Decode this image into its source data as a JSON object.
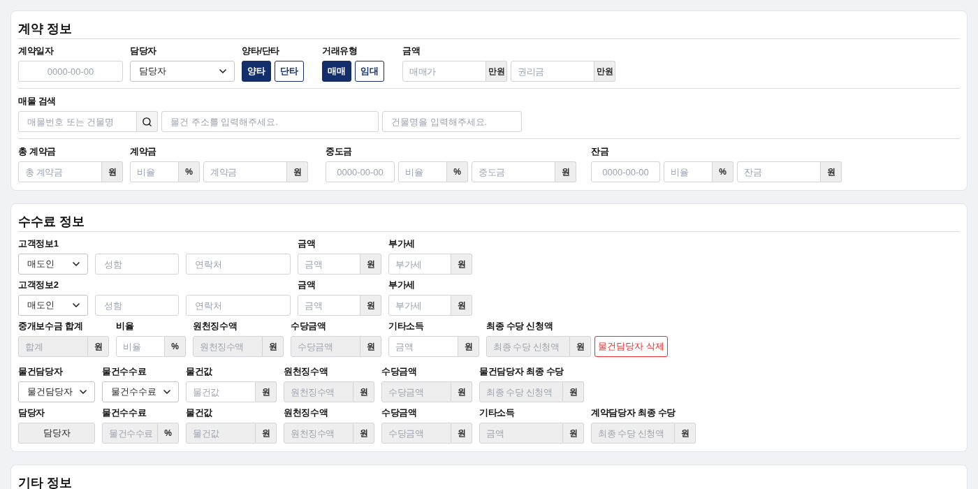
{
  "sections": [
    {
      "title": "계약 정보",
      "rows": [
        {
          "groups": [
            {
              "label": "계약일자",
              "controls": [
                {
                  "kind": "date",
                  "placeholder": "0000-00-00",
                  "disabled": false
                }
              ]
            },
            {
              "label": "담당자",
              "controls": [
                {
                  "kind": "select",
                  "value": "담당자"
                }
              ]
            },
            {
              "label": "양타/단타",
              "controls": [
                {
                  "kind": "toggle",
                  "label": "양타",
                  "selected": true
                },
                {
                  "kind": "toggle",
                  "label": "단타",
                  "selected": false
                }
              ]
            },
            {
              "label": "거래유형",
              "controls": [
                {
                  "kind": "toggle",
                  "label": "매매",
                  "selected": true
                },
                {
                  "kind": "toggle",
                  "label": "임대",
                  "selected": false
                }
              ]
            },
            {
              "label": "금액",
              "controls": [
                {
                  "kind": "unit",
                  "placeholder": "매매가",
                  "unit": "만원",
                  "disabled": false
                },
                {
                  "kind": "unit",
                  "placeholder": "권리금",
                  "unit": "만원",
                  "disabled": false
                }
              ]
            }
          ]
        },
        {
          "groups": [
            {
              "label": "매물 검색",
              "controls": [
                {
                  "kind": "search",
                  "placeholder": "매물번호 또는 건물명"
                },
                {
                  "kind": "input",
                  "placeholder": "물건 주소를 입력해주세요.",
                  "disabled": false
                },
                {
                  "kind": "input",
                  "placeholder": "건물명을 입력해주세요.",
                  "disabled": false
                }
              ]
            }
          ]
        },
        {
          "groups": [
            {
              "label": "총 계약금",
              "controls": [
                {
                  "kind": "unit",
                  "placeholder": "총 계약금",
                  "unit": "원",
                  "disabled": false
                }
              ]
            },
            {
              "label": "계약금",
              "controls": [
                {
                  "kind": "unit",
                  "placeholder": "비율",
                  "unit": "%",
                  "disabled": false
                },
                {
                  "kind": "unit",
                  "placeholder": "계약금",
                  "unit": "원",
                  "disabled": false
                }
              ]
            },
            {
              "label": "중도금",
              "controls": [
                {
                  "kind": "date",
                  "placeholder": "0000-00-00",
                  "disabled": false
                },
                {
                  "kind": "unit",
                  "placeholder": "비율",
                  "unit": "%",
                  "disabled": false
                },
                {
                  "kind": "unit",
                  "placeholder": "중도금",
                  "unit": "원",
                  "disabled": false
                }
              ]
            },
            {
              "label": "잔금",
              "controls": [
                {
                  "kind": "date",
                  "placeholder": "0000-00-00",
                  "disabled": false
                },
                {
                  "kind": "unit",
                  "placeholder": "비율",
                  "unit": "%",
                  "disabled": false
                },
                {
                  "kind": "unit",
                  "placeholder": "잔금",
                  "unit": "원",
                  "disabled": false
                }
              ]
            }
          ]
        }
      ]
    },
    {
      "title": "수수료 정보",
      "rows": [
        {
          "groups": [
            {
              "label": "고객정보1",
              "controls": [
                {
                  "kind": "select",
                  "value": "매도인"
                },
                {
                  "kind": "input",
                  "placeholder": "성함",
                  "disabled": false
                },
                {
                  "kind": "input",
                  "placeholder": "연락처",
                  "disabled": false
                }
              ]
            },
            {
              "label": "금액",
              "controls": [
                {
                  "kind": "unit",
                  "placeholder": "금액",
                  "unit": "원",
                  "disabled": false
                }
              ]
            },
            {
              "label": "부가세",
              "controls": [
                {
                  "kind": "unit",
                  "placeholder": "부가세",
                  "unit": "원",
                  "disabled": false
                }
              ]
            }
          ]
        },
        {
          "groups": [
            {
              "label": "고객정보2",
              "controls": [
                {
                  "kind": "select",
                  "value": "매도인"
                },
                {
                  "kind": "input",
                  "placeholder": "성함",
                  "disabled": false
                },
                {
                  "kind": "input",
                  "placeholder": "연락처",
                  "disabled": false
                }
              ]
            },
            {
              "label": "금액",
              "controls": [
                {
                  "kind": "unit",
                  "placeholder": "금액",
                  "unit": "원",
                  "disabled": false
                }
              ]
            },
            {
              "label": "부가세",
              "controls": [
                {
                  "kind": "unit",
                  "placeholder": "부가세",
                  "unit": "원",
                  "disabled": false
                }
              ]
            }
          ]
        },
        {
          "groups": [
            {
              "label": "중개보수금 합계",
              "controls": [
                {
                  "kind": "unit",
                  "placeholder": "합계",
                  "unit": "원",
                  "disabled": true
                }
              ]
            },
            {
              "label": "비율",
              "controls": [
                {
                  "kind": "unit",
                  "placeholder": "비율",
                  "unit": "%",
                  "disabled": false
                }
              ]
            },
            {
              "label": "원천징수액",
              "controls": [
                {
                  "kind": "unit",
                  "placeholder": "원천징수액",
                  "unit": "원",
                  "disabled": true
                }
              ]
            },
            {
              "label": "수당금액",
              "controls": [
                {
                  "kind": "unit",
                  "placeholder": "수당금액",
                  "unit": "원",
                  "disabled": true
                }
              ]
            },
            {
              "label": "기타소득",
              "controls": [
                {
                  "kind": "unit",
                  "placeholder": "금액",
                  "unit": "원",
                  "disabled": false
                }
              ]
            },
            {
              "label": "최종 수당 신청액",
              "controls": [
                {
                  "kind": "unit",
                  "placeholder": "최종 수당 신청액",
                  "unit": "원",
                  "disabled": true
                }
              ]
            },
            {
              "controls": [
                {
                  "kind": "danger",
                  "label": "물건담당자 삭제"
                }
              ]
            }
          ]
        },
        {
          "groups": [
            {
              "label": "물건담당자",
              "controls": [
                {
                  "kind": "select",
                  "value": "물건담당자"
                }
              ]
            },
            {
              "label": "물건수수료",
              "controls": [
                {
                  "kind": "select",
                  "value": "물건수수료"
                }
              ]
            },
            {
              "label": "물건값",
              "controls": [
                {
                  "kind": "unit",
                  "placeholder": "물건값",
                  "unit": "원",
                  "disabled": false
                }
              ]
            },
            {
              "label": "원천징수액",
              "controls": [
                {
                  "kind": "unit",
                  "placeholder": "원천징수액",
                  "unit": "원",
                  "disabled": true
                }
              ]
            },
            {
              "label": "수당금액",
              "controls": [
                {
                  "kind": "unit",
                  "placeholder": "수당금액",
                  "unit": "원",
                  "disabled": true
                }
              ]
            },
            {
              "label": "물건담당자 최종 수당",
              "controls": [
                {
                  "kind": "unit",
                  "placeholder": "최종 수당 신청액",
                  "unit": "원",
                  "disabled": true
                }
              ]
            }
          ]
        },
        {
          "groups": [
            {
              "label": "담당자",
              "controls": [
                {
                  "kind": "static",
                  "text": "담당자"
                }
              ]
            },
            {
              "label": "물건수수료",
              "controls": [
                {
                  "kind": "unit",
                  "placeholder": "물건수수료",
                  "unit": "%",
                  "disabled": true
                }
              ]
            },
            {
              "label": "물건값",
              "controls": [
                {
                  "kind": "unit",
                  "placeholder": "물건값",
                  "unit": "원",
                  "disabled": true
                }
              ]
            },
            {
              "label": "원천징수액",
              "controls": [
                {
                  "kind": "unit",
                  "placeholder": "원천징수액",
                  "unit": "원",
                  "disabled": true
                }
              ]
            },
            {
              "label": "수당금액",
              "controls": [
                {
                  "kind": "unit",
                  "placeholder": "수당금액",
                  "unit": "원",
                  "disabled": true
                }
              ]
            },
            {
              "label": "기타소득",
              "controls": [
                {
                  "kind": "unit",
                  "placeholder": "금액",
                  "unit": "원",
                  "disabled": true
                }
              ]
            },
            {
              "label": "계약담당자 최종 수당",
              "controls": [
                {
                  "kind": "unit",
                  "placeholder": "최종 수당 신청액",
                  "unit": "원",
                  "disabled": true
                }
              ]
            }
          ]
        }
      ]
    },
    {
      "title": "기타 정보"
    }
  ]
}
